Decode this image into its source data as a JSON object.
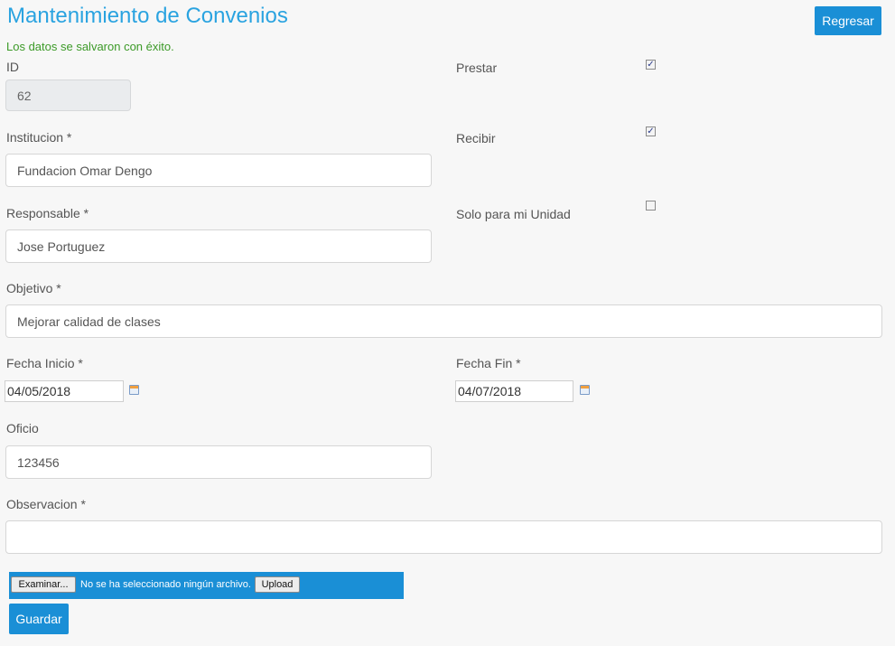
{
  "page": {
    "title": "Mantenimiento de Convenios",
    "success_message": "Los datos se salvaron con éxito."
  },
  "header": {
    "back_button": "Regresar"
  },
  "form": {
    "id": {
      "label": "ID",
      "value": "62"
    },
    "institucion": {
      "label": "Institucion *",
      "value": "Fundacion Omar Dengo"
    },
    "responsable": {
      "label": "Responsable *",
      "value": "Jose Portuguez"
    },
    "objetivo": {
      "label": "Objetivo *",
      "value": "Mejorar calidad de clases"
    },
    "fecha_inicio": {
      "label": "Fecha Inicio *",
      "value": "04/05/2018"
    },
    "fecha_fin": {
      "label": "Fecha Fin *",
      "value": "04/07/2018"
    },
    "oficio": {
      "label": "Oficio",
      "value": "123456"
    },
    "observacion": {
      "label": "Observacion *",
      "value": ""
    },
    "prestar": {
      "label": "Prestar",
      "checked": true
    },
    "recibir": {
      "label": "Recibir",
      "checked": true
    },
    "solo_unidad": {
      "label": "Solo para mi Unidad",
      "checked": false
    }
  },
  "upload": {
    "browse_label": "Examinar...",
    "no_file_text": "No se ha seleccionado ningún archivo.",
    "upload_label": "Upload"
  },
  "actions": {
    "save_label": "Guardar"
  },
  "icons": {
    "calendar": "calendar-icon",
    "checkmark": "✓"
  },
  "colors": {
    "accent": "#1a8fd6",
    "title": "#2aa3e0",
    "success": "#3c9a28"
  }
}
